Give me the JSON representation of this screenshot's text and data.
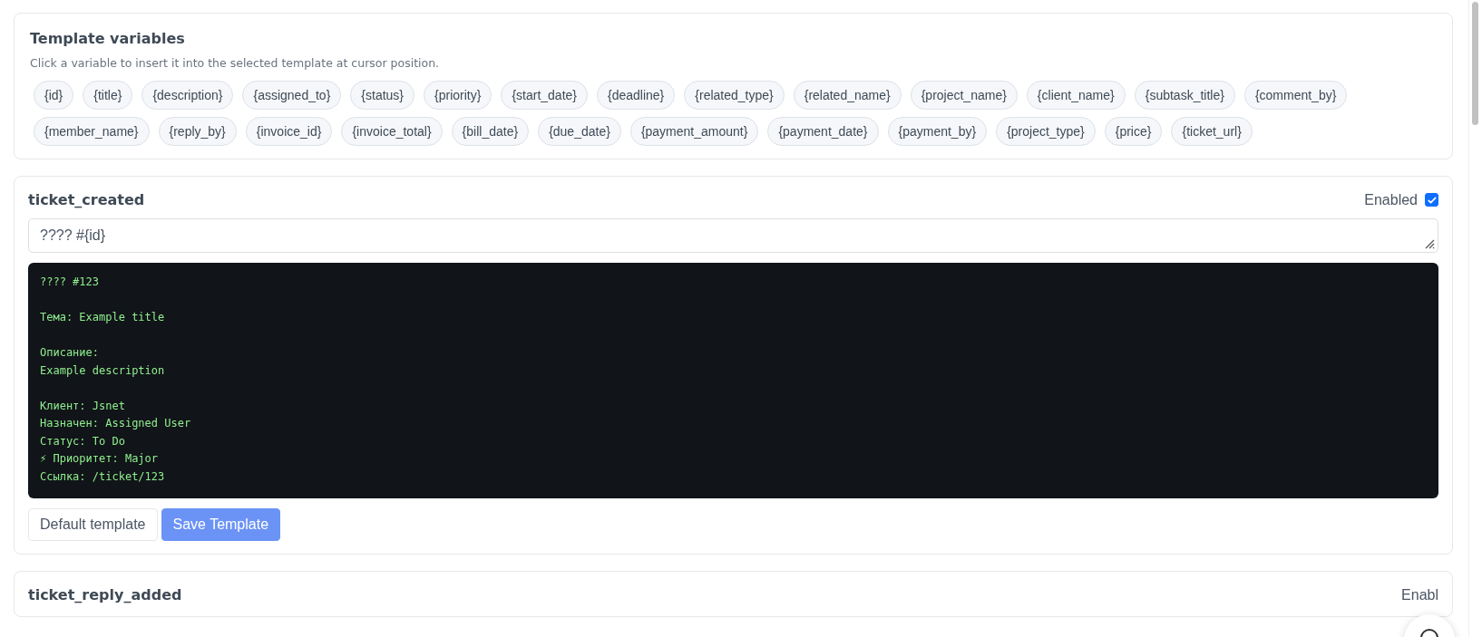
{
  "variables_card": {
    "title": "Template variables",
    "hint": "Click a variable to insert it into the selected template at cursor position.",
    "variables": [
      "{id}",
      "{title}",
      "{description}",
      "{assigned_to}",
      "{status}",
      "{priority}",
      "{start_date}",
      "{deadline}",
      "{related_type}",
      "{related_name}",
      "{project_name}",
      "{client_name}",
      "{subtask_title}",
      "{comment_by}",
      "{member_name}",
      "{reply_by}",
      "{invoice_id}",
      "{invoice_total}",
      "{bill_date}",
      "{due_date}",
      "{payment_amount}",
      "{payment_date}",
      "{payment_by}",
      "{project_type}",
      "{price}",
      "{ticket_url}"
    ]
  },
  "templates": [
    {
      "name": "ticket_created",
      "enabled_label": "Enabled",
      "enabled": true,
      "subject": "???? #{id}",
      "preview": [
        [
          "???? #123"
        ],
        [
          "Тема: Example title"
        ],
        [
          "Описание:",
          "Example description"
        ],
        [
          "Клиент: Jsnet",
          "Назначен: Assigned User",
          "Статус: To Do",
          "⚡ Приоритет: Major",
          "Ссылка: /ticket/123"
        ]
      ],
      "buttons": [
        "Default template",
        "Save Template"
      ]
    },
    {
      "name": "ticket_reply_added",
      "enabled_label": "Enabl"
    }
  ]
}
